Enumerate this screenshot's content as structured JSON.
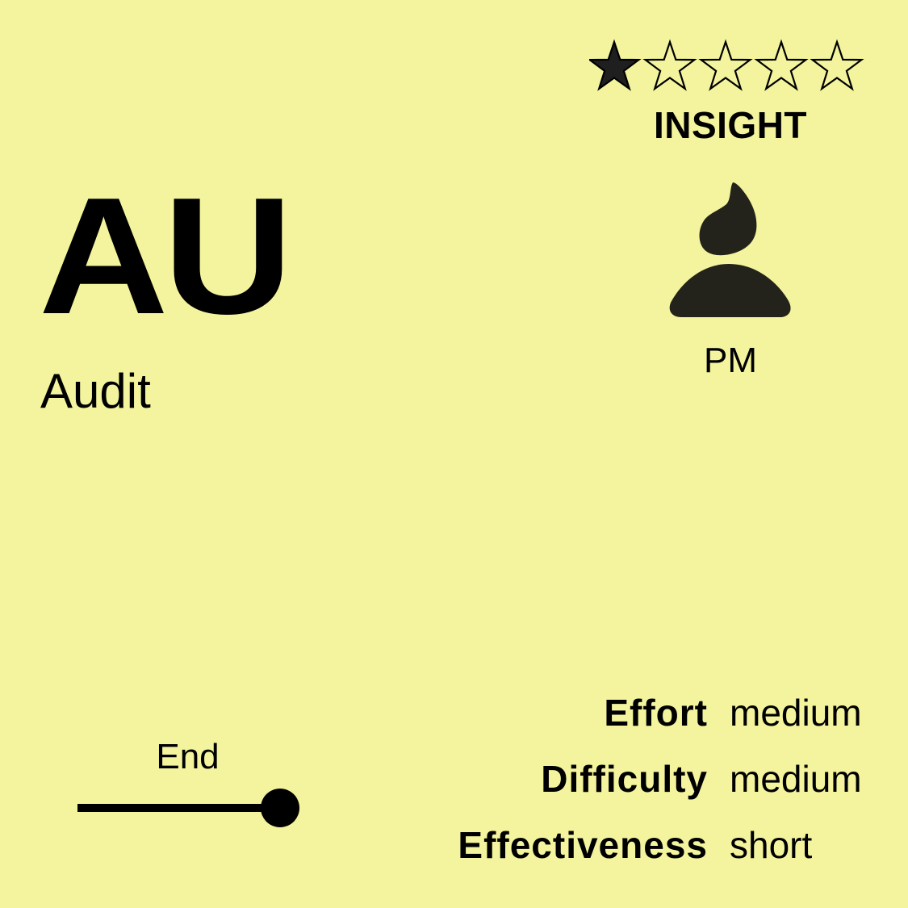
{
  "card": {
    "background": "#f3f49d",
    "ink": "#000000",
    "rating": {
      "value": 1,
      "max": 5
    },
    "category": "INSIGHT",
    "abbreviation": "AU",
    "name": "Audit",
    "role": {
      "icon": "person-icon",
      "label": "PM"
    },
    "phase": {
      "label": "End",
      "position": 1.0
    },
    "stats": [
      {
        "label": "Effort",
        "value": "medium"
      },
      {
        "label": "Difficulty",
        "value": "medium"
      },
      {
        "label": "Effectiveness",
        "value": "short"
      }
    ]
  }
}
